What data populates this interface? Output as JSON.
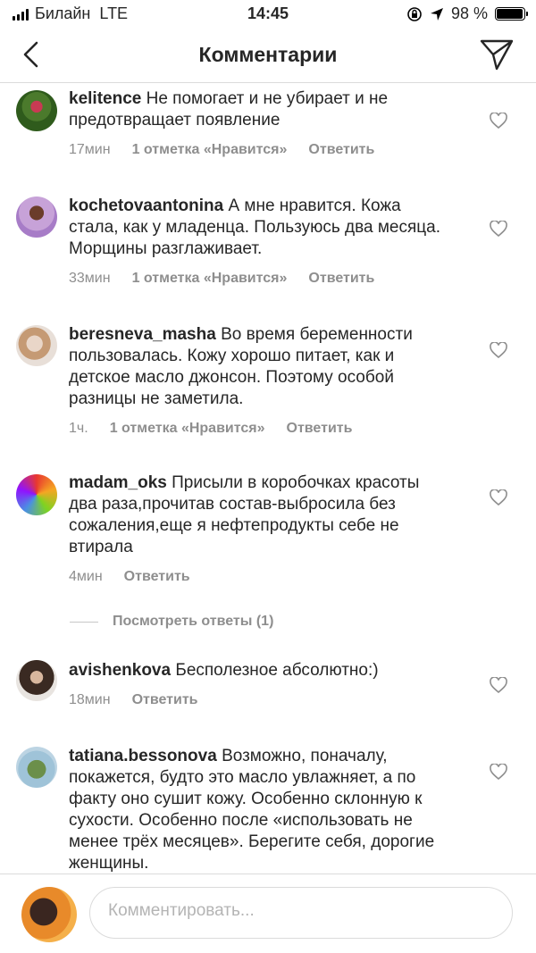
{
  "status_bar": {
    "carrier": "Билайн",
    "network": "LTE",
    "time": "14:45",
    "battery": "98 %",
    "battery_level": 0.98
  },
  "header": {
    "title": "Комментарии",
    "back_icon": "chevron-left-icon",
    "send_icon": "paper-plane-icon"
  },
  "comments": [
    {
      "username": "kelitence",
      "text": "Не помогает и не убирает и не предотвращает появление",
      "time": "17мин",
      "likes": "1 отметка «Нравится»",
      "reply": "Ответить"
    },
    {
      "username": "kochetovaantonina",
      "text": "А мне нравится. Кожа стала, как у младенца. Пользуюсь два месяца. Морщины разглаживает.",
      "time": "33мин",
      "likes": "1 отметка «Нравится»",
      "reply": "Ответить"
    },
    {
      "username": "beresneva_masha",
      "text": "Во время беременности пользовалась. Кожу хорошо питает, как и детское масло джонсон. Поэтому особой разницы не заметила.",
      "time": "1ч.",
      "likes": "1 отметка «Нравится»",
      "reply": "Ответить"
    },
    {
      "username": "madam_oks",
      "text": "Присыли в коробочках красоты два раза,прочитав состав-выбросила без сожаления,еще я нефтепродукты себе не втирала",
      "time": "4мин",
      "reply": "Ответить"
    },
    {
      "username": "avishenkova",
      "text": "Бесполезное абсолютно:)",
      "time": "18мин",
      "reply": "Ответить"
    },
    {
      "username": "tatiana.bessonova",
      "text": "Возможно, поначалу, покажется, будто это масло увлажняет, а по факту оно сушит кожу. Особенно склонную к сухости. Особенно после «использовать не менее трёх месяцев». Берегите себя, дорогие женщины."
    }
  ],
  "view_replies": "Посмотреть ответы (1)",
  "input": {
    "placeholder": "Комментировать..."
  },
  "colors": {
    "text": "#262626",
    "meta": "#8e8e8e",
    "divider": "#dbdbdb"
  }
}
